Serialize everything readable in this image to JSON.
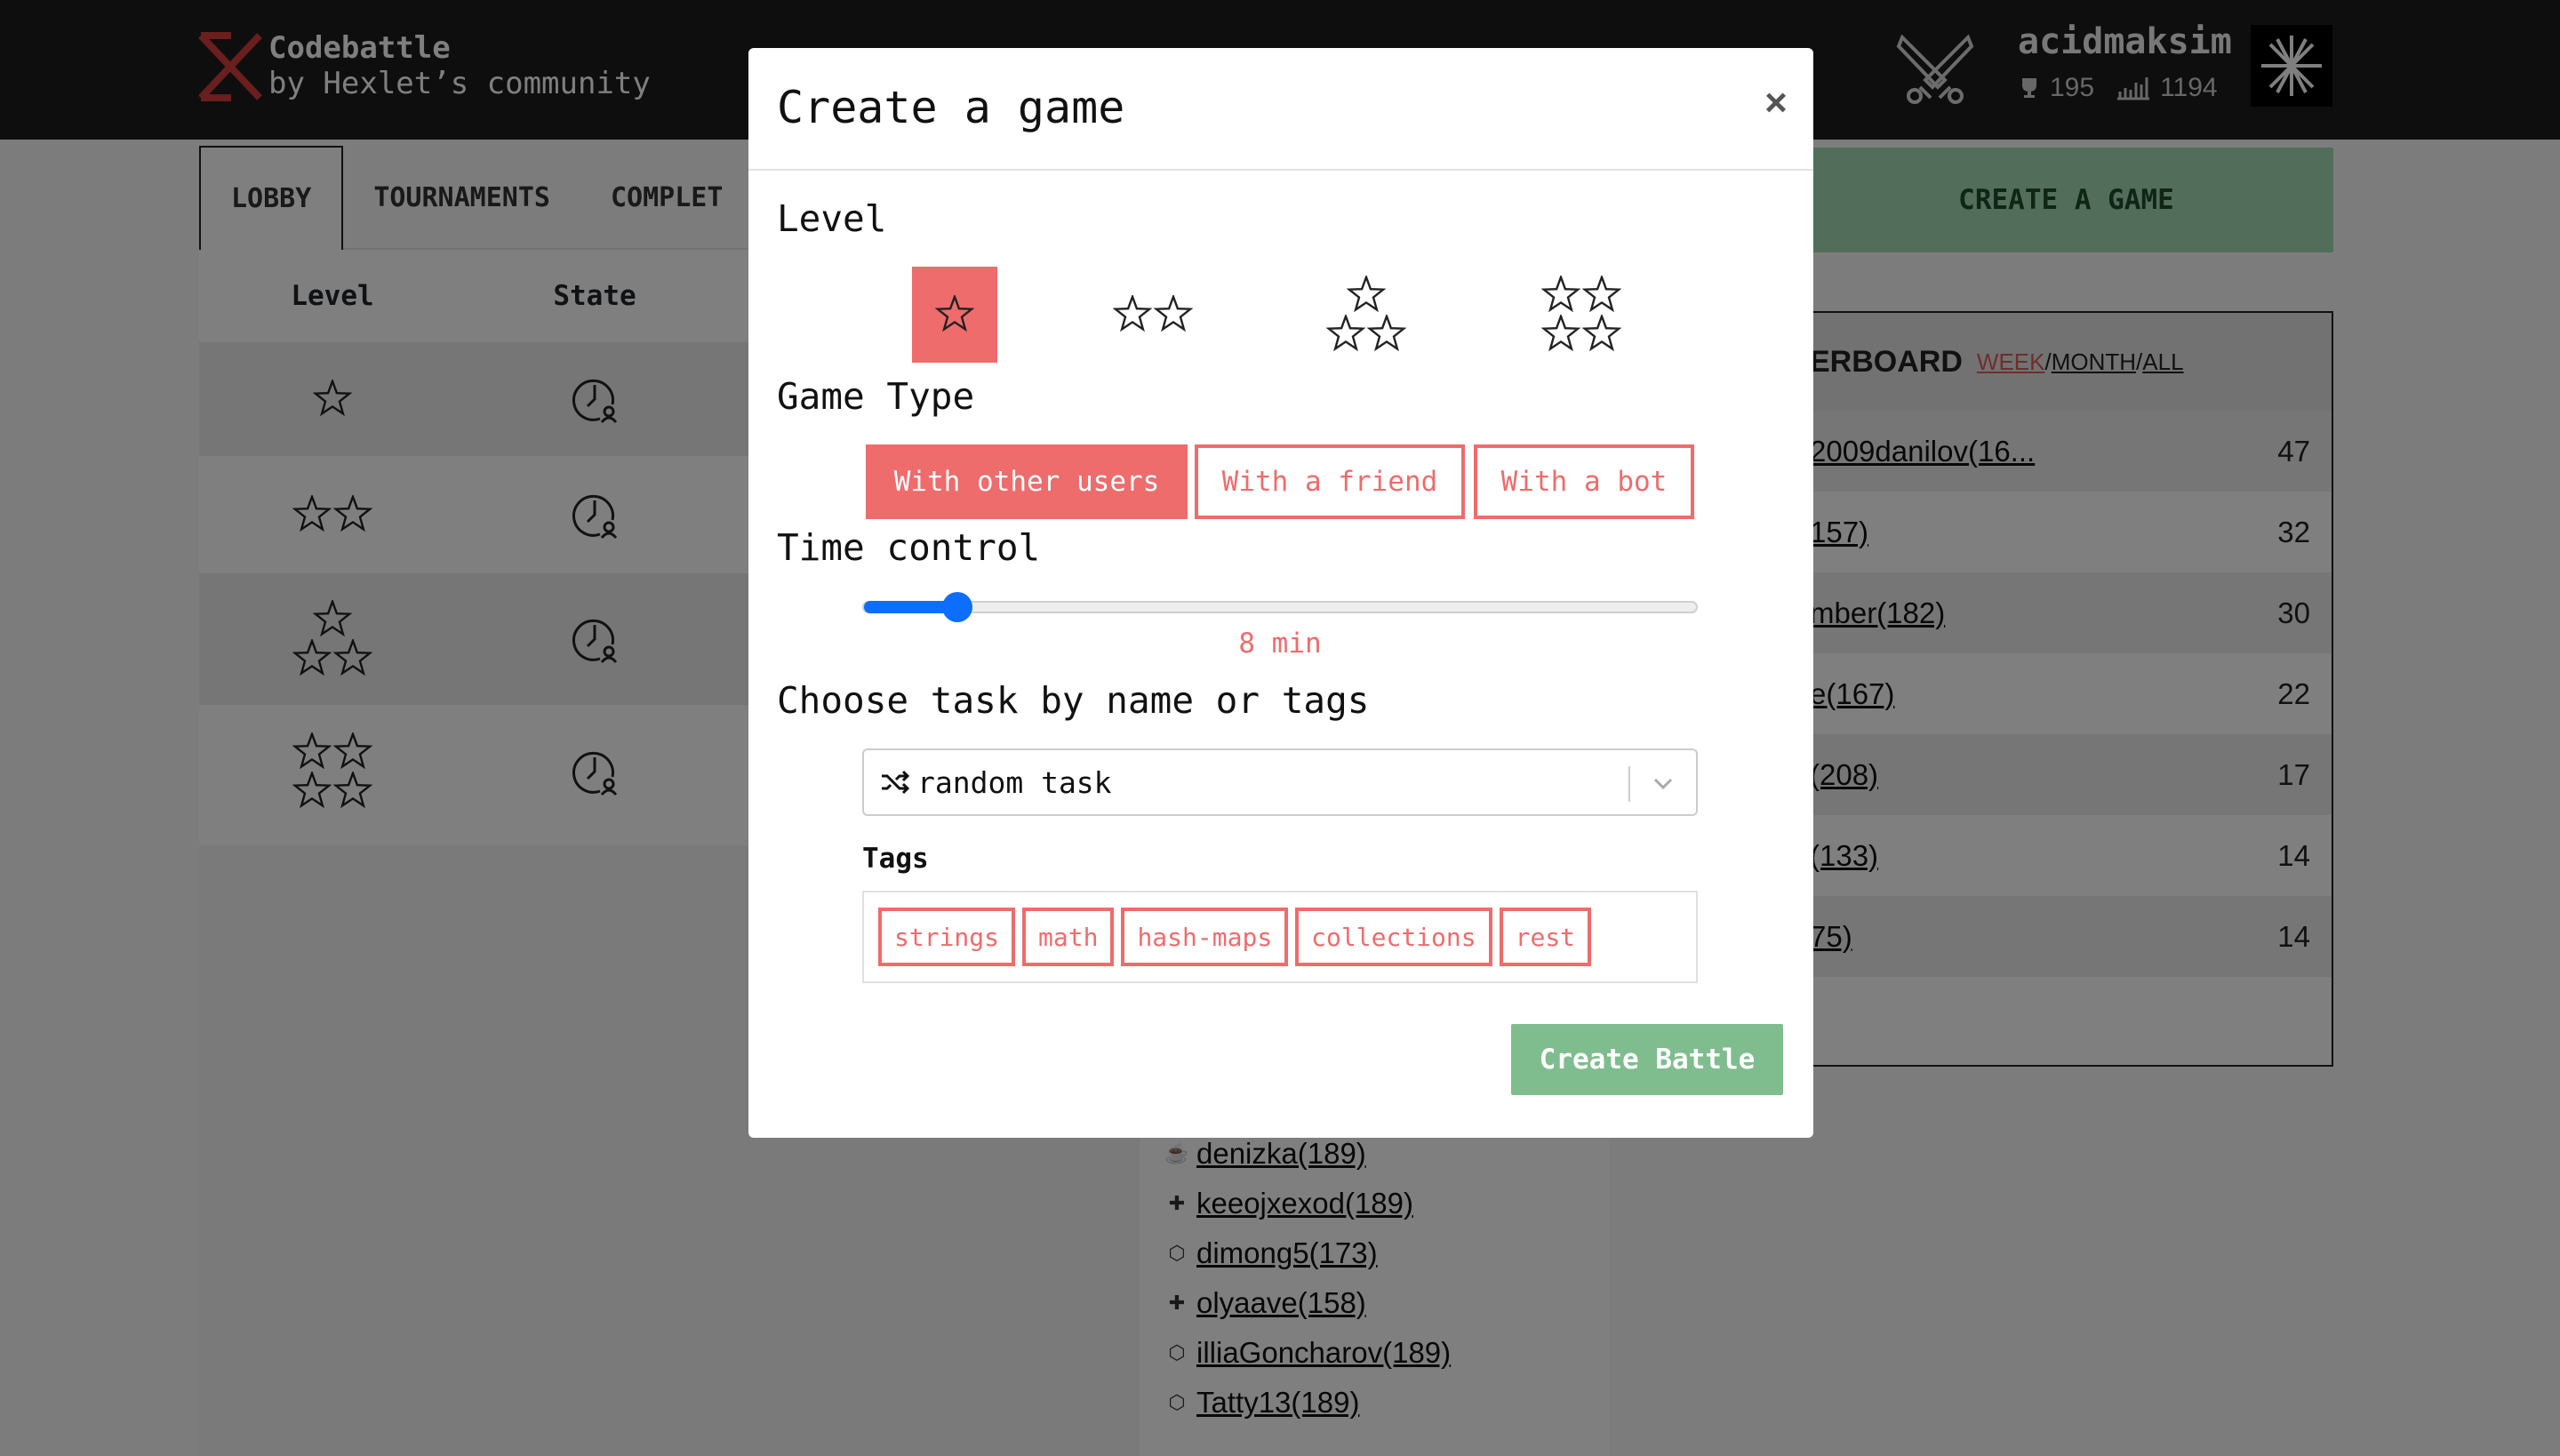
{
  "header": {
    "brand_title": "Codebattle",
    "brand_subtitle": "by Hexlet’s community",
    "username": "acidmaksim",
    "rank": "195",
    "rating": "1194"
  },
  "lobby": {
    "tabs": [
      {
        "label": "LOBBY",
        "active": true
      },
      {
        "label": "TOURNAMENTS",
        "active": false
      },
      {
        "label": "COMPLET",
        "active": false
      }
    ],
    "columns": [
      "Level",
      "State"
    ],
    "rows": [
      {
        "level_stars": 1,
        "state": "waiting-icon"
      },
      {
        "level_stars": 2,
        "state": "waiting-icon"
      },
      {
        "level_stars": 3,
        "state": "waiting-icon"
      },
      {
        "level_stars": 4,
        "state": "waiting-icon"
      }
    ]
  },
  "create_game_button": "CREATE A GAME",
  "leaderboard": {
    "title": "ERBOARD",
    "periods": [
      "WEEK",
      "MONTH",
      "ALL"
    ],
    "active_period": "WEEK",
    "rows": [
      {
        "name": "2009danilov(16...",
        "score": "47"
      },
      {
        "name": "157)",
        "score": "32"
      },
      {
        "name": "mber(182)",
        "score": "30"
      },
      {
        "name": "e(167)",
        "score": "22"
      },
      {
        "name": "(208)",
        "score": "17"
      },
      {
        "name": "(133)",
        "score": "14"
      },
      {
        "name": "75)",
        "score": "14"
      }
    ]
  },
  "online_users": [
    {
      "name": "denizka(189)",
      "lang": "java"
    },
    {
      "name": "keeojxexod(189)",
      "lang": "python"
    },
    {
      "name": "dimong5(173)",
      "lang": "js"
    },
    {
      "name": "olyaave(158)",
      "lang": "python"
    },
    {
      "name": "illiaGoncharov(189)",
      "lang": "js"
    },
    {
      "name": "Tatty13(189)",
      "lang": "js"
    }
  ],
  "modal": {
    "title": "Create a game",
    "close_label": "×",
    "level_label": "Level",
    "levels": [
      {
        "name": "elementary",
        "stars": 1,
        "selected": true
      },
      {
        "name": "easy",
        "stars": 2,
        "selected": false
      },
      {
        "name": "medium",
        "stars": 3,
        "selected": false
      },
      {
        "name": "hard",
        "stars": 4,
        "selected": false
      }
    ],
    "game_type_label": "Game Type",
    "game_types": [
      {
        "label": "With other users",
        "active": true
      },
      {
        "label": "With a friend",
        "active": false
      },
      {
        "label": "With a bot",
        "active": false
      }
    ],
    "time_control_label": "Time control",
    "time_control_value": "8 min",
    "time_control_fraction": 0.1,
    "task_label": "Choose task by name or tags",
    "task_value": "random task",
    "tags_label": "Tags",
    "tags": [
      "strings",
      "math",
      "hash-maps",
      "collections",
      "rest"
    ],
    "submit_label": "Create Battle"
  },
  "colors": {
    "accent": "#ee6c6c",
    "primary": "#0d6efd",
    "success": "#7fbd8f"
  }
}
